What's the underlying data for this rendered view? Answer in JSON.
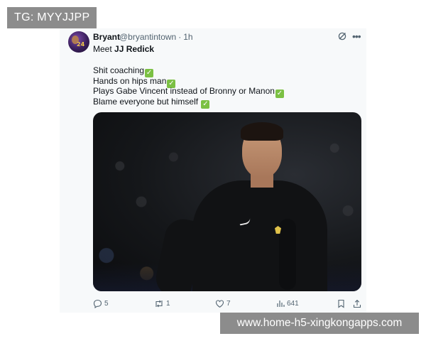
{
  "overlays": {
    "top_left_tag": "TG: MYYJJPP",
    "bottom_right_url": "www.home-h5-xingkongapps.com"
  },
  "tweet": {
    "author_name": "Bryant",
    "handle": "@bryantintown",
    "separator": "·",
    "time": "1h",
    "intro_prefix": "Meet ",
    "intro_name": "JJ Redick",
    "lines": [
      "Shit coaching",
      "Hands on hips man",
      "Plays Gabe Vincent instead of Bronny or Manon",
      "Blame everyone but himself "
    ],
    "check_glyph": "✓",
    "avatar_number": "24",
    "actions": {
      "replies": "5",
      "retweets": "1",
      "likes": "7",
      "views": "641"
    }
  },
  "icons": {
    "grok": "grok-icon",
    "more": "more-icon",
    "reply": "reply-icon",
    "retweet": "retweet-icon",
    "like": "heart-icon",
    "views": "views-icon",
    "bookmark": "bookmark-icon",
    "share": "share-icon"
  },
  "colors": {
    "check_green": "#7bc043",
    "muted": "#536471",
    "overlay_gray": "#8c8c8c"
  }
}
